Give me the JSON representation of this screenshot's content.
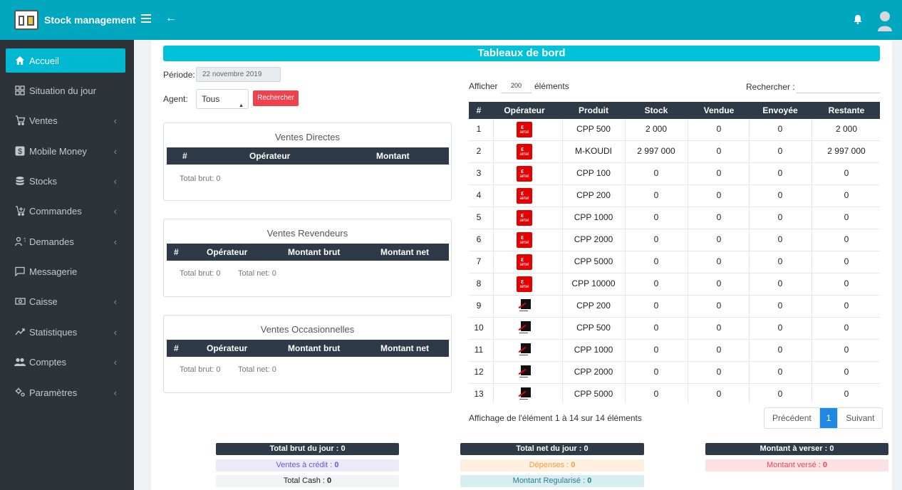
{
  "app": {
    "title": "Stock management"
  },
  "sidebar": {
    "items": [
      {
        "label": "Accueil",
        "icon": "home-icon",
        "active": true,
        "chevron": false
      },
      {
        "label": "Situation du jour",
        "icon": "dashboard-icon",
        "chevron": false
      },
      {
        "label": "Ventes",
        "icon": "cart-icon",
        "chevron": true
      },
      {
        "label": "Mobile Money",
        "icon": "dollar-icon",
        "chevron": true
      },
      {
        "label": "Stocks",
        "icon": "database-icon",
        "chevron": true
      },
      {
        "label": "Commandes",
        "icon": "cart-plus-icon",
        "chevron": true
      },
      {
        "label": "Demandes",
        "icon": "user-question-icon",
        "chevron": true
      },
      {
        "label": "Messagerie",
        "icon": "message-icon",
        "chevron": false
      },
      {
        "label": "Caisse",
        "icon": "cash-icon",
        "chevron": true
      },
      {
        "label": "Statistiques",
        "icon": "chart-icon",
        "chevron": true
      },
      {
        "label": "Comptes",
        "icon": "users-icon",
        "chevron": true
      },
      {
        "label": "Paramètres",
        "icon": "settings-icon",
        "chevron": true
      }
    ]
  },
  "main": {
    "title": "Tableaux de bord",
    "period_label": "Période:",
    "period_value": "22 novembre 2019",
    "agent_label": "Agent:",
    "agent_value": "Tous",
    "search_button": "Rechercher",
    "cards": {
      "directes": {
        "title": "Ventes Directes",
        "headers": [
          "#",
          "Opérateur",
          "Montant"
        ],
        "total_brut": "Total brut: 0"
      },
      "revendeurs": {
        "title": "Ventes Revendeurs",
        "headers": [
          "#",
          "Opérateur",
          "Montant brut",
          "Montant net"
        ],
        "total_brut": "Total brut: 0",
        "total_net": "Total net: 0"
      },
      "occasionnelles": {
        "title": "Ventes Occasionnelles",
        "headers": [
          "#",
          "Opérateur",
          "Montant brut",
          "Montant net"
        ],
        "total_brut": "Total brut: 0",
        "total_net": "Total net: 0"
      }
    },
    "table": {
      "show_label": "Afficher",
      "show_value": "200",
      "show_suffix": "éléments",
      "search_label": "Rechercher :",
      "headers": [
        "#",
        "Opérateur",
        "Produit",
        "Stock",
        "Vendue",
        "Envoyée",
        "Restante"
      ],
      "rows": [
        {
          "n": "1",
          "op": "airtel",
          "produit": "CPP 500",
          "stock": "2 000",
          "vendue": "0",
          "envoyee": "0",
          "restante": "2 000"
        },
        {
          "n": "2",
          "op": "airtel",
          "produit": "M-KOUDI",
          "stock": "2 997 000",
          "vendue": "0",
          "envoyee": "0",
          "restante": "2 997 000"
        },
        {
          "n": "3",
          "op": "airtel",
          "produit": "CPP 100",
          "stock": "0",
          "vendue": "0",
          "envoyee": "0",
          "restante": "0"
        },
        {
          "n": "4",
          "op": "airtel",
          "produit": "CPP 200",
          "stock": "0",
          "vendue": "0",
          "envoyee": "0",
          "restante": "0"
        },
        {
          "n": "5",
          "op": "airtel",
          "produit": "CPP 1000",
          "stock": "0",
          "vendue": "0",
          "envoyee": "0",
          "restante": "0"
        },
        {
          "n": "6",
          "op": "airtel",
          "produit": "CPP 2000",
          "stock": "0",
          "vendue": "0",
          "envoyee": "0",
          "restante": "0"
        },
        {
          "n": "7",
          "op": "airtel",
          "produit": "CPP 5000",
          "stock": "0",
          "vendue": "0",
          "envoyee": "0",
          "restante": "0"
        },
        {
          "n": "8",
          "op": "airtel",
          "produit": "CPP 10000",
          "stock": "0",
          "vendue": "0",
          "envoyee": "0",
          "restante": "0"
        },
        {
          "n": "9",
          "op": "mcell",
          "produit": "CPP 200",
          "stock": "0",
          "vendue": "0",
          "envoyee": "0",
          "restante": "0"
        },
        {
          "n": "10",
          "op": "mcell",
          "produit": "CPP 500",
          "stock": "0",
          "vendue": "0",
          "envoyee": "0",
          "restante": "0"
        },
        {
          "n": "11",
          "op": "mcell",
          "produit": "CPP 1000",
          "stock": "0",
          "vendue": "0",
          "envoyee": "0",
          "restante": "0"
        },
        {
          "n": "12",
          "op": "mcell",
          "produit": "CPP 2000",
          "stock": "0",
          "vendue": "0",
          "envoyee": "0",
          "restante": "0"
        },
        {
          "n": "13",
          "op": "mcell",
          "produit": "CPP 5000",
          "stock": "0",
          "vendue": "0",
          "envoyee": "0",
          "restante": "0"
        }
      ],
      "info": "Affichage de l'élément 1 à 14 sur 14 éléments",
      "prev": "Précédent",
      "current_page": "1",
      "next": "Suivant"
    },
    "summary": {
      "total_brut_jour": "Total brut du jour : ",
      "total_brut_jour_val": "0",
      "ventes_credit": "Ventes à crédit : ",
      "ventes_credit_val": "0",
      "total_cash": "Total Cash : ",
      "total_cash_val": "0",
      "total_net_jour": "Total net du jour : ",
      "total_net_jour_val": "0",
      "depenses": "Dépenses : ",
      "depenses_val": "0",
      "montant_regularise": "Montant Regularisé : ",
      "montant_regularise_val": "0",
      "montant_verser": "Montant à verser : ",
      "montant_verser_val": "0",
      "montant_verse": "Montant versé : ",
      "montant_verse_val": "0"
    }
  },
  "colors": {
    "topbar": "#00a7bf",
    "sidebar": "#2e3338",
    "active": "#00b8d0",
    "table_head": "#2f3a49",
    "search_button": "#f0414f",
    "pagination_active": "#1e88e5"
  },
  "airtel_logo_text": "airtel"
}
